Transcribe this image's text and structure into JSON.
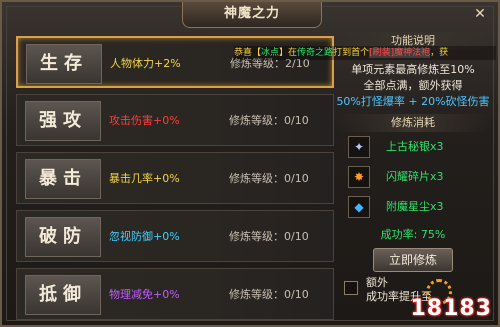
{
  "window": {
    "title": "神魔之力",
    "close_label": "✕"
  },
  "notice": {
    "prefix": "恭喜【",
    "player": "冰点",
    "mid1": "】在",
    "location": "传奇之路",
    "mid2": "打到首个",
    "item": "[刷装]魔神法袍",
    "suffix": "，获"
  },
  "skills": [
    {
      "name": "生存",
      "attr": "人物体力+2%",
      "attr_color": "#f2d548",
      "level": "修炼等级：2/10",
      "selected": true
    },
    {
      "name": "强攻",
      "attr": "攻击伤害+0%",
      "attr_color": "#ff3c3c",
      "level": "修炼等级：0/10",
      "selected": false
    },
    {
      "name": "暴击",
      "attr": "暴击几率+0%",
      "attr_color": "#f2d548",
      "level": "修炼等级：0/10",
      "selected": false
    },
    {
      "name": "破防",
      "attr": "忽视防御+0%",
      "attr_color": "#3fd0ff",
      "level": "修炼等级：0/10",
      "selected": false
    },
    {
      "name": "抵御",
      "attr": "物理减免+0%",
      "attr_color": "#c05cff",
      "level": "修炼等级：0/10",
      "selected": false
    }
  ],
  "info": {
    "head": "功能说明",
    "line1": "单项元素最高修炼至10%",
    "line2": "全部点满，额外获得",
    "line3": "50%打怪爆率 + 20%砍怪伤害"
  },
  "cost": {
    "head": "修炼消耗",
    "materials": [
      {
        "name": "上古秘银x3",
        "icon": "crystal-icon",
        "glyph": "✦",
        "color": "#b9c7ff"
      },
      {
        "name": "闪耀碎片x3",
        "icon": "shard-icon",
        "glyph": "✸",
        "color": "#ff9c2a"
      },
      {
        "name": "附魔星尘x3",
        "icon": "stardust-icon",
        "glyph": "◆",
        "color": "#3fb6ff"
      }
    ],
    "rate": "成功率: 75%",
    "button": "立即修炼"
  },
  "options": {
    "line1": "额外",
    "line2": "成功率提升至"
  },
  "watermark": "18183"
}
